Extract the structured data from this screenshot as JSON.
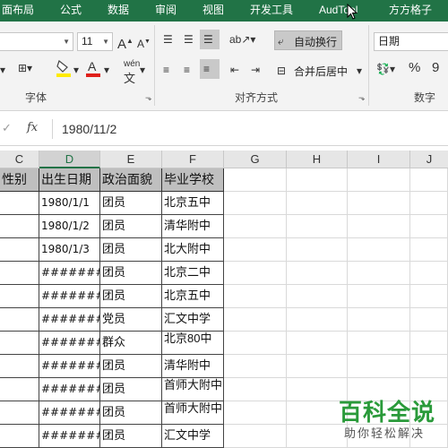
{
  "ribbon_tabs": [
    "面布局",
    "公式",
    "数据",
    "审阅",
    "视图",
    "开发工具",
    "AudTool",
    "方方格子"
  ],
  "ribbon": {
    "font_size": "11",
    "wen_label": "wén",
    "wrap_text": "自动换行",
    "merge_center": "合并后居中",
    "number_format": "日期",
    "percent": "%",
    "comma": "9",
    "group_font": "字体",
    "group_align": "对齐方式",
    "group_number": "数字"
  },
  "formula_bar": {
    "fx": "fx",
    "value": "1980/11/2"
  },
  "columns": [
    "C",
    "D",
    "E",
    "F",
    "G",
    "H",
    "I",
    "J"
  ],
  "table_header": [
    "性别",
    "出生日期",
    "政治面貌",
    "毕业学校"
  ],
  "rows": [
    [
      "",
      "1980/1/1",
      "团员",
      "北京五中"
    ],
    [
      "",
      "1980/1/2",
      "团员",
      "清华附中"
    ],
    [
      "",
      "1980/1/3",
      "团员",
      "北大附中"
    ],
    [
      "",
      "########",
      "团员",
      "北京二中"
    ],
    [
      "",
      "########",
      "团员",
      "北京五中"
    ],
    [
      "",
      "########",
      "党员",
      "汇文中学"
    ],
    [
      "",
      "########",
      "群众",
      "北京80中"
    ],
    [
      "",
      "########",
      "团员",
      "清华附中"
    ],
    [
      "",
      "########",
      "团员",
      "首师大附中"
    ],
    [
      "",
      "########",
      "团员",
      "首师大附中"
    ],
    [
      "",
      "########",
      "团员",
      "汇文中学"
    ]
  ],
  "watermark": {
    "title": "百科全说",
    "subtitle": "助你轻松解决"
  },
  "colors": {
    "ribbon_green": "#217346",
    "header_fill": "#bfbfbf",
    "watermark_green": "#2a9a3a"
  }
}
